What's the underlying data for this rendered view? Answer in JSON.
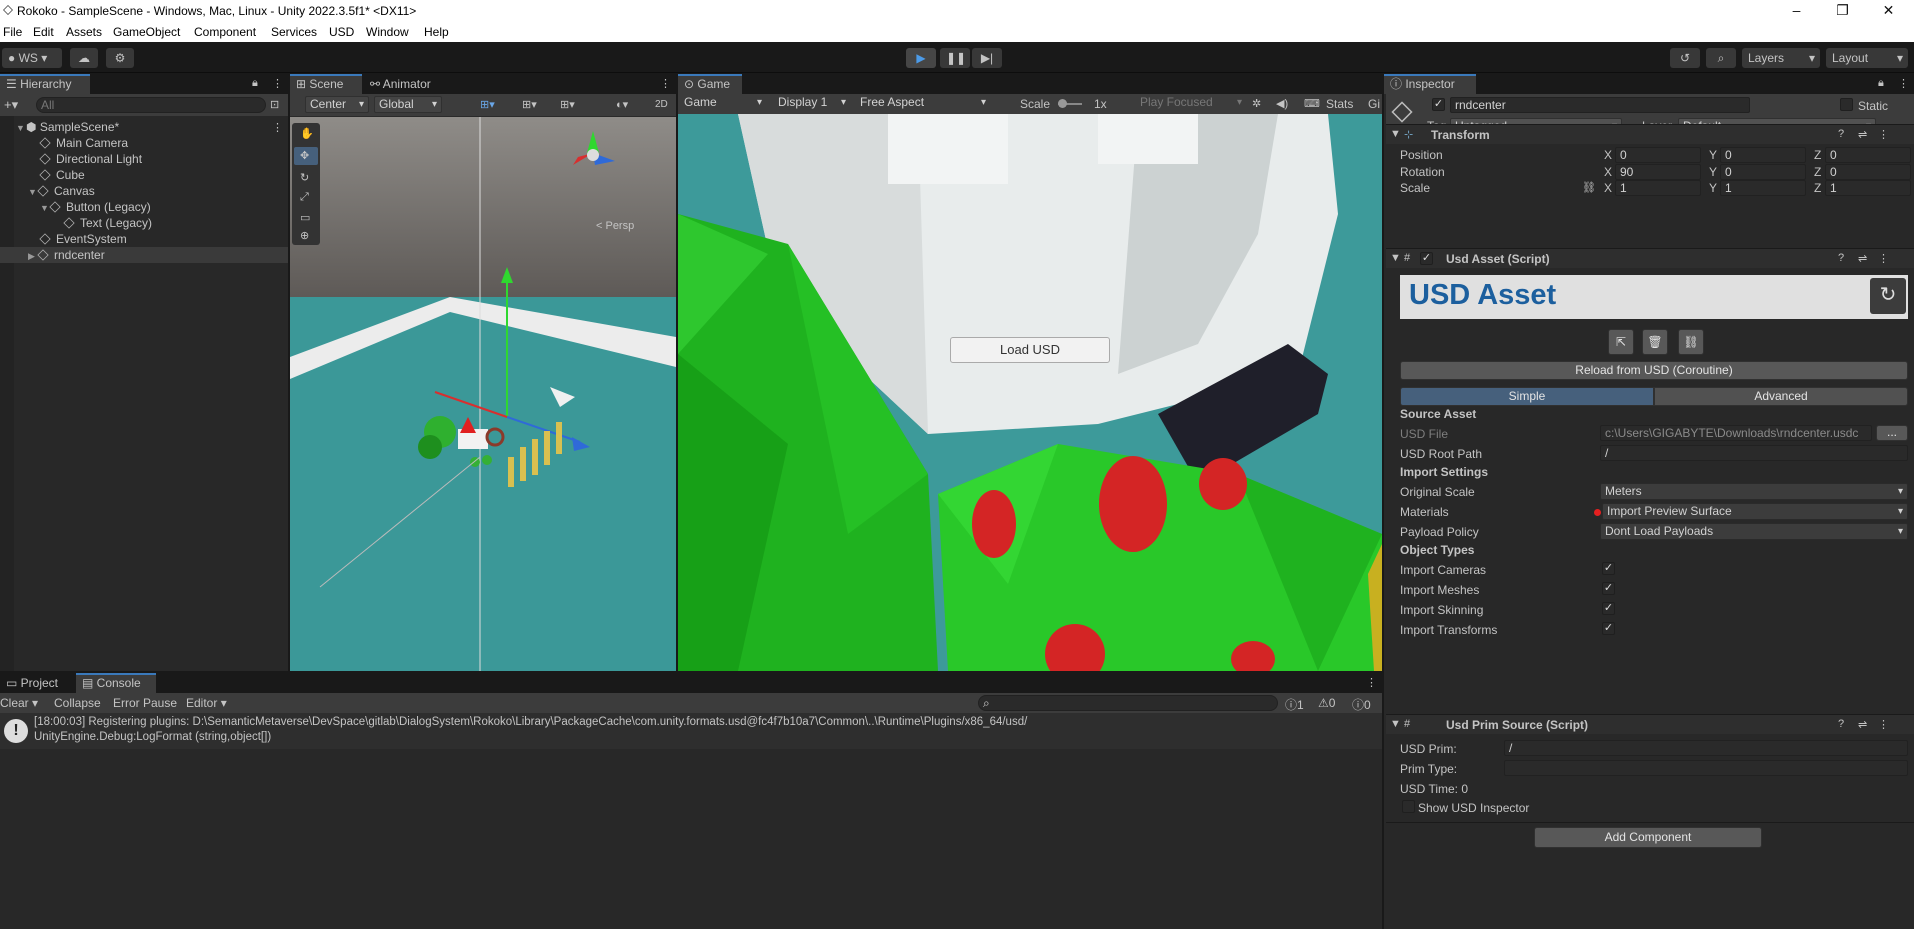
{
  "window": {
    "title": "Rokoko - SampleScene - Windows, Mac, Linux - Unity 2022.3.5f1* <DX11>"
  },
  "menu": [
    "File",
    "Edit",
    "Assets",
    "GameObject",
    "Component",
    "Services",
    "USD",
    "Window",
    "Help"
  ],
  "toolbar": {
    "account": "WS",
    "layers": "Layers",
    "layout": "Layout"
  },
  "hierarchy": {
    "tab": "Hierarchy",
    "search_placeholder": "All",
    "scene": "SampleScene*",
    "items": [
      {
        "label": "Main Camera",
        "depth": 1
      },
      {
        "label": "Directional Light",
        "depth": 1
      },
      {
        "label": "Cube",
        "depth": 1
      },
      {
        "label": "Canvas",
        "depth": 1
      },
      {
        "label": "Button (Legacy)",
        "depth": 2
      },
      {
        "label": "Text (Legacy)",
        "depth": 3
      },
      {
        "label": "EventSystem",
        "depth": 1
      },
      {
        "label": "rndcenter",
        "depth": 1
      }
    ]
  },
  "scene_view": {
    "tab": "Scene",
    "tab2": "Animator",
    "pivot": "Center",
    "space": "Global",
    "mode2d": "2D",
    "persp": "< Persp"
  },
  "game_view": {
    "tab": "Game",
    "mode": "Game",
    "display": "Display 1",
    "aspect": "Free Aspect",
    "scale_label": "Scale",
    "scale_value": "1x",
    "play_focused": "Play Focused",
    "stats": "Stats",
    "gizmos": "Gi",
    "button": "Load USD"
  },
  "inspector": {
    "tab": "Inspector",
    "object_name": "rndcenter",
    "static": "Static",
    "tag_label": "Tag",
    "tag": "Untagged",
    "layer_label": "Layer",
    "layer": "Default",
    "transform": {
      "title": "Transform",
      "position_label": "Position",
      "position": [
        "0",
        "0",
        "0"
      ],
      "rotation_label": "Rotation",
      "rotation": [
        "90",
        "0",
        "0"
      ],
      "scale_label": "Scale",
      "scale": [
        "1",
        "1",
        "1"
      ]
    },
    "usd_asset": {
      "title": "Usd Asset (Script)",
      "banner": "USD Asset",
      "reload": "Reload from USD (Coroutine)",
      "simple": "Simple",
      "advanced": "Advanced",
      "source_asset": "Source Asset",
      "usd_file_label": "USD File",
      "usd_file": "c:\\Users\\GIGABYTE\\Downloads\\rndcenter.usdc",
      "browse": "...",
      "root_path_label": "USD Root Path",
      "root_path": "/",
      "import_settings": "Import Settings",
      "original_scale_label": "Original Scale",
      "original_scale": "Meters",
      "materials_label": "Materials",
      "materials": "Import Preview Surface",
      "payload_label": "Payload Policy",
      "payload": "Dont Load Payloads",
      "object_types": "Object Types",
      "types": [
        "Import Cameras",
        "Import Meshes",
        "Import Skinning",
        "Import Transforms"
      ]
    },
    "prim_source": {
      "title": "Usd Prim Source (Script)",
      "prim_label": "USD Prim:",
      "prim": "/",
      "type_label": "Prim Type:",
      "time": "USD Time: 0",
      "show": "Show USD Inspector"
    },
    "add_component": "Add Component"
  },
  "console": {
    "tab_project": "Project",
    "tab_console": "Console",
    "clear": "Clear",
    "collapse": "Collapse",
    "error_pause": "Error Pause",
    "editor": "Editor",
    "count_log": "1",
    "count_warn": "0",
    "count_err": "0",
    "line1": "[18:00:03] Registering plugins: D:\\SemanticMetaverse\\DevSpace\\gitlab\\DialogSystem\\Rokoko\\Library\\PackageCache\\com.unity.formats.usd@fc4f7b10a7\\Common\\..\\Runtime\\Plugins/x86_64/usd/",
    "line2": "UnityEngine.Debug:LogFormat (string,object[])"
  }
}
